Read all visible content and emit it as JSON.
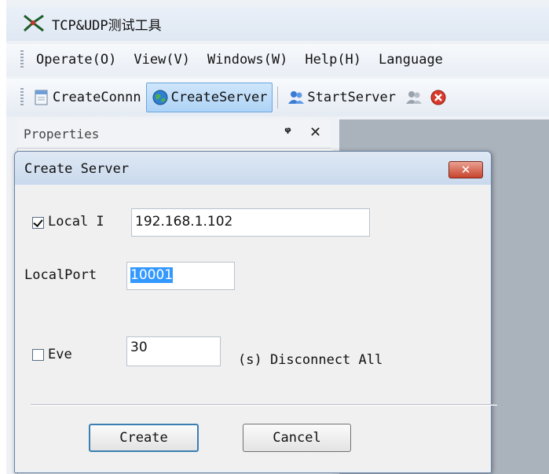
{
  "app": {
    "title": "TCP&UDP测试工具"
  },
  "menu": {
    "items": [
      "Operate(O)",
      "View(V)",
      "Windows(W)",
      "Help(H)",
      "Language"
    ]
  },
  "toolbar": {
    "create_connection": "CreateConnn",
    "create_server": "CreateServer",
    "start_server": "StartServer"
  },
  "properties": {
    "title": "Properties"
  },
  "dialog": {
    "title": "Create Server",
    "local_ip_label": "Local I",
    "local_ip_checked": true,
    "local_ip_value": "192.168.1.102",
    "local_port_label": "LocalPort",
    "local_port_value": "10001",
    "every_label": "Eve",
    "every_checked": false,
    "every_value": "30",
    "disconnect_label": "(s) Disconnect All",
    "create_label": "Create",
    "cancel_label": "Cancel"
  },
  "colors": {
    "selection": "#3399ff",
    "close_button": "#c8432c",
    "workspace": "#aab2bc"
  }
}
